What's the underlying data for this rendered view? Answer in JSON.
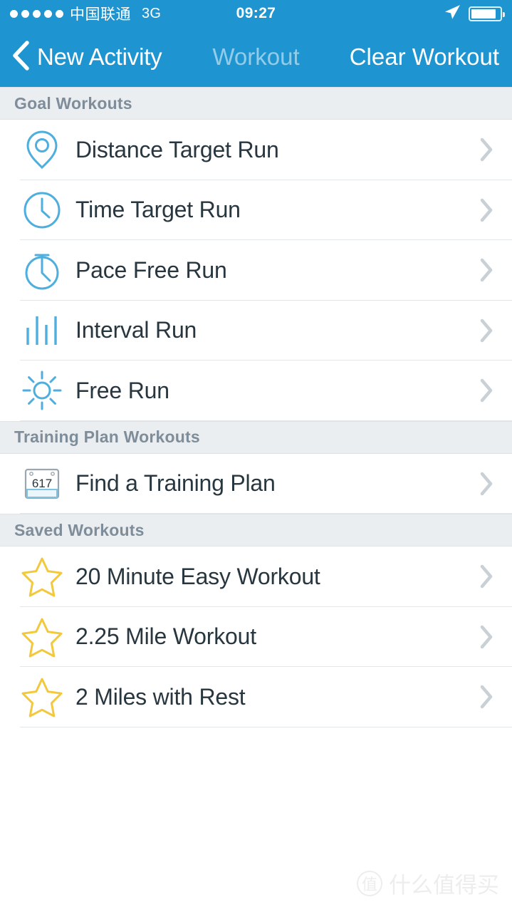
{
  "status_bar": {
    "signal_dots": 5,
    "carrier": "中国联通",
    "network": "3G",
    "time": "09:27",
    "battery_level_percent": 88
  },
  "nav_bar": {
    "back_label": "New Activity",
    "title": "Workout",
    "action_label": "Clear Workout",
    "background_color": "#1e95d0",
    "text_color": "#ffffff",
    "title_color": "#8fc9e6"
  },
  "theme": {
    "icon_blue": "#4eaede",
    "star_yellow": "#f2c83c",
    "row_text": "#27363f",
    "header_text": "#7e8d99",
    "header_bg": "#ebeef0",
    "chevron": "#c9d1d6",
    "separator": "#e3e6e8"
  },
  "sections": [
    {
      "header": "Goal Workouts",
      "rows": [
        {
          "label": "Distance Target Run",
          "icon": "map-pin-icon"
        },
        {
          "label": "Time Target Run",
          "icon": "clock-icon"
        },
        {
          "label": "Pace Free Run",
          "icon": "stopwatch-icon"
        },
        {
          "label": "Interval Run",
          "icon": "interval-bars-icon"
        },
        {
          "label": "Free Run",
          "icon": "sun-icon"
        }
      ]
    },
    {
      "header": "Training Plan Workouts",
      "rows": [
        {
          "label": "Find a Training Plan",
          "icon": "calendar-icon",
          "icon_text": "617"
        }
      ]
    },
    {
      "header": "Saved Workouts",
      "rows": [
        {
          "label": "20 Minute Easy Workout",
          "icon": "star-icon"
        },
        {
          "label": "2.25 Mile Workout",
          "icon": "star-icon"
        },
        {
          "label": "2 Miles with Rest",
          "icon": "star-icon"
        }
      ]
    }
  ],
  "watermark": {
    "logo_char": "值",
    "text": "什么值得买"
  }
}
